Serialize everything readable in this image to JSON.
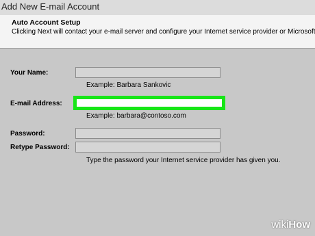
{
  "window": {
    "title": "Add New E-mail Account"
  },
  "header": {
    "title": "Auto Account Setup",
    "description": "Clicking Next will contact your e-mail server and configure your Internet service provider or Microsoft B"
  },
  "form": {
    "name_label": "Your Name:",
    "name_value": "",
    "name_hint": "Example: Barbara Sankovic",
    "email_label": "E-mail Address:",
    "email_value": "",
    "email_hint": "Example: barbara@contoso.com",
    "password_label": "Password:",
    "password_value": "",
    "retype_label": "Retype Password:",
    "retype_value": "",
    "password_hint": "Type the password your Internet service provider has given you."
  },
  "watermark": {
    "part1": "wiki",
    "part2": "How"
  },
  "colors": {
    "highlight": "#17e617",
    "background": "#c8c8c8",
    "header_background": "#f4f4f4"
  }
}
